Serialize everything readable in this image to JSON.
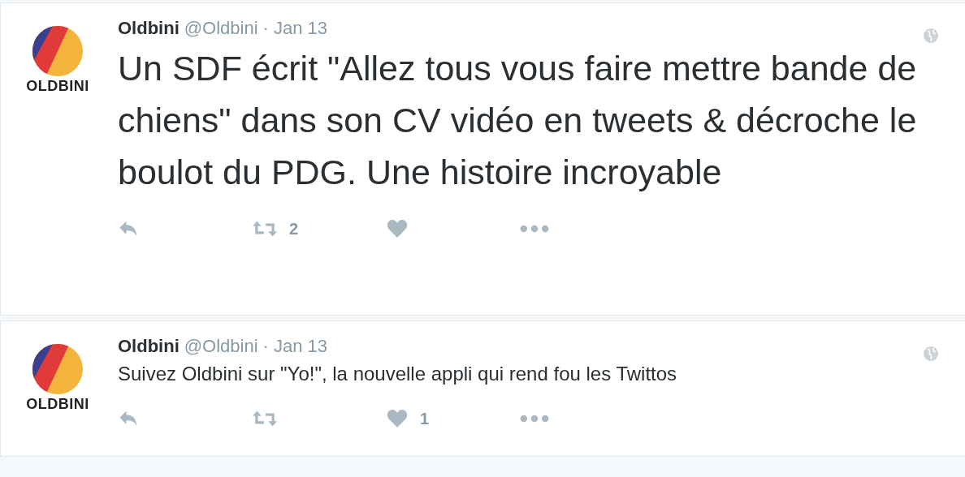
{
  "tweets": [
    {
      "avatar_label": "OLDBINI",
      "name": "Oldbini",
      "handle": "@Oldbini",
      "date": "· Jan 13",
      "kind": "large",
      "text": "Un SDF écrit \"Allez tous vous faire mettre bande de chiens\" dans son CV vidéo en tweets & décroche le boulot du PDG. Une histoire incroyable",
      "retweets": "2"
    },
    {
      "avatar_label": "OLDBINI",
      "name": "Oldbini",
      "handle": "@Oldbini",
      "date": "· Jan 13",
      "kind": "normal",
      "text": "Suivez Oldbini sur \"Yo!\", la nouvelle appli qui rend fou les Twittos",
      "likes": "1"
    }
  ]
}
